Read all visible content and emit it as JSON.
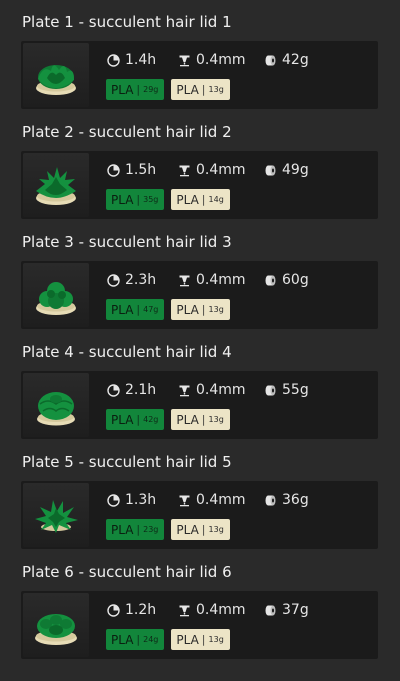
{
  "colors": {
    "background": "#2a2a2a",
    "card": "#1b1b1b",
    "filament_green": "#12863b",
    "filament_cream": "#ece4c6"
  },
  "icons": {
    "time": "clock-icon",
    "nozzle": "nozzle-icon",
    "weight": "filament-spool-icon"
  },
  "plates": [
    {
      "title": "Plate 1 - succulent hair lid 1",
      "time": "1.4h",
      "nozzle": "0.4mm",
      "weight": "42g",
      "filaments": [
        {
          "type": "PLA",
          "sep": "|",
          "amount": "29g",
          "color": "green"
        },
        {
          "type": "PLA",
          "sep": "|",
          "amount": "13g",
          "color": "cream"
        }
      ]
    },
    {
      "title": "Plate 2 - succulent hair lid 2",
      "time": "1.5h",
      "nozzle": "0.4mm",
      "weight": "49g",
      "filaments": [
        {
          "type": "PLA",
          "sep": "|",
          "amount": "35g",
          "color": "green"
        },
        {
          "type": "PLA",
          "sep": "|",
          "amount": "14g",
          "color": "cream"
        }
      ]
    },
    {
      "title": "Plate 3 - succulent hair lid 3",
      "time": "2.3h",
      "nozzle": "0.4mm",
      "weight": "60g",
      "filaments": [
        {
          "type": "PLA",
          "sep": "|",
          "amount": "47g",
          "color": "green"
        },
        {
          "type": "PLA",
          "sep": "|",
          "amount": "13g",
          "color": "cream"
        }
      ]
    },
    {
      "title": "Plate 4 - succulent hair lid 4",
      "time": "2.1h",
      "nozzle": "0.4mm",
      "weight": "55g",
      "filaments": [
        {
          "type": "PLA",
          "sep": "|",
          "amount": "42g",
          "color": "green"
        },
        {
          "type": "PLA",
          "sep": "|",
          "amount": "13g",
          "color": "cream"
        }
      ]
    },
    {
      "title": "Plate 5 - succulent hair lid 5",
      "time": "1.3h",
      "nozzle": "0.4mm",
      "weight": "36g",
      "filaments": [
        {
          "type": "PLA",
          "sep": "|",
          "amount": "23g",
          "color": "green"
        },
        {
          "type": "PLA",
          "sep": "|",
          "amount": "13g",
          "color": "cream"
        }
      ]
    },
    {
      "title": "Plate 6 - succulent hair lid 6",
      "time": "1.2h",
      "nozzle": "0.4mm",
      "weight": "37g",
      "filaments": [
        {
          "type": "PLA",
          "sep": "|",
          "amount": "24g",
          "color": "green"
        },
        {
          "type": "PLA",
          "sep": "|",
          "amount": "13g",
          "color": "cream"
        }
      ]
    }
  ]
}
